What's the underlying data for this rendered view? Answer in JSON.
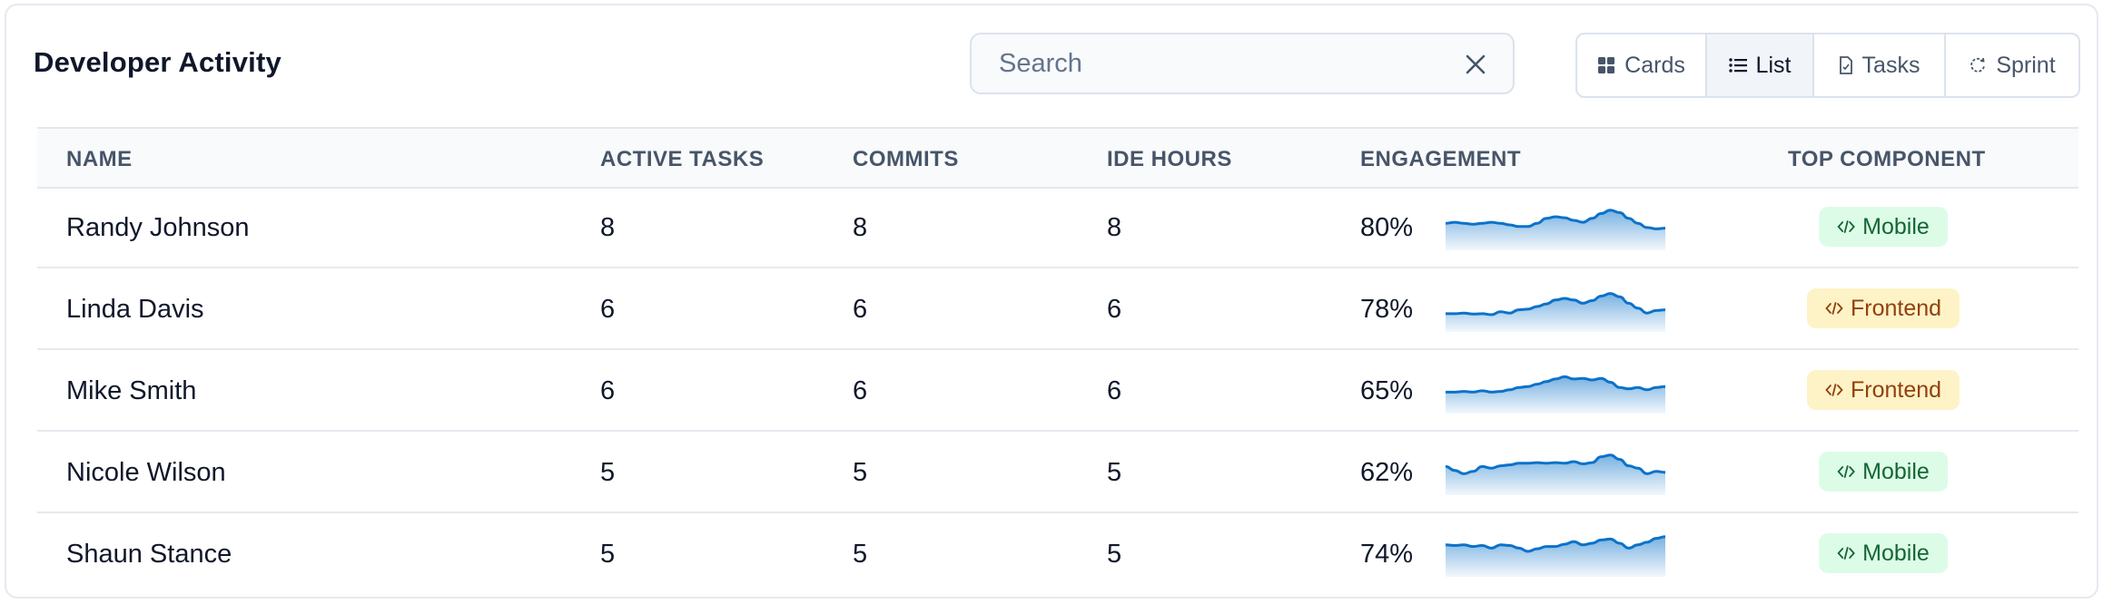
{
  "title": "Developer Activity",
  "search": {
    "placeholder": "Search",
    "value": ""
  },
  "views": [
    {
      "label": "Cards",
      "icon": "grid-icon",
      "active": false
    },
    {
      "label": "List",
      "icon": "list-icon",
      "active": true
    },
    {
      "label": "Tasks",
      "icon": "document-icon",
      "active": false
    },
    {
      "label": "Sprint",
      "icon": "cycle-icon",
      "active": false
    }
  ],
  "columns": [
    "NAME",
    "ACTIVE TASKS",
    "COMMITS",
    "IDE HOURS",
    "ENGAGEMENT",
    "TOP COMPONENT"
  ],
  "colors": {
    "spark_line": "#0b72c9",
    "mobile": "#166534",
    "frontend": "#92400e"
  },
  "rows": [
    {
      "name": "Randy Johnson",
      "active_tasks": "8",
      "commits": "8",
      "ide_hours": "8",
      "engagement": "80%",
      "component": "Mobile",
      "component_type": "mobile",
      "trend": [
        0.45,
        0.42,
        0.45,
        0.48,
        0.45,
        0.42,
        0.45,
        0.5,
        0.55,
        0.55,
        0.45,
        0.3,
        0.25,
        0.28,
        0.36,
        0.42,
        0.3,
        0.15,
        0.05,
        0.12,
        0.3,
        0.45,
        0.58,
        0.62,
        0.6
      ]
    },
    {
      "name": "Linda Davis",
      "active_tasks": "6",
      "commits": "6",
      "ide_hours": "6",
      "engagement": "78%",
      "component": "Frontend",
      "component_type": "frontend",
      "trend": [
        0.72,
        0.72,
        0.7,
        0.73,
        0.72,
        0.75,
        0.66,
        0.7,
        0.6,
        0.58,
        0.5,
        0.42,
        0.3,
        0.25,
        0.3,
        0.4,
        0.32,
        0.18,
        0.1,
        0.2,
        0.4,
        0.55,
        0.7,
        0.62,
        0.6
      ]
    },
    {
      "name": "Mike Smith",
      "active_tasks": "6",
      "commits": "6",
      "ide_hours": "6",
      "engagement": "65%",
      "component": "Frontend",
      "component_type": "frontend",
      "trend": [
        0.62,
        0.62,
        0.6,
        0.62,
        0.58,
        0.62,
        0.6,
        0.55,
        0.48,
        0.45,
        0.38,
        0.3,
        0.22,
        0.15,
        0.22,
        0.2,
        0.25,
        0.2,
        0.32,
        0.48,
        0.52,
        0.48,
        0.55,
        0.48,
        0.45
      ]
    },
    {
      "name": "Nicole Wilson",
      "active_tasks": "5",
      "commits": "5",
      "ide_hours": "5",
      "engagement": "62%",
      "component": "Mobile",
      "component_type": "mobile",
      "trend": [
        0.4,
        0.52,
        0.62,
        0.55,
        0.4,
        0.45,
        0.38,
        0.35,
        0.3,
        0.3,
        0.28,
        0.3,
        0.28,
        0.3,
        0.25,
        0.32,
        0.28,
        0.1,
        0.05,
        0.18,
        0.38,
        0.45,
        0.62,
        0.55,
        0.58
      ]
    },
    {
      "name": "Shaun Stance",
      "active_tasks": "5",
      "commits": "5",
      "ide_hours": "5",
      "engagement": "74%",
      "component": "Mobile",
      "component_type": "mobile",
      "trend": [
        0.3,
        0.32,
        0.3,
        0.35,
        0.32,
        0.4,
        0.3,
        0.32,
        0.4,
        0.5,
        0.42,
        0.35,
        0.35,
        0.28,
        0.2,
        0.3,
        0.25,
        0.15,
        0.12,
        0.25,
        0.4,
        0.3,
        0.22,
        0.1,
        0.05
      ]
    }
  ]
}
